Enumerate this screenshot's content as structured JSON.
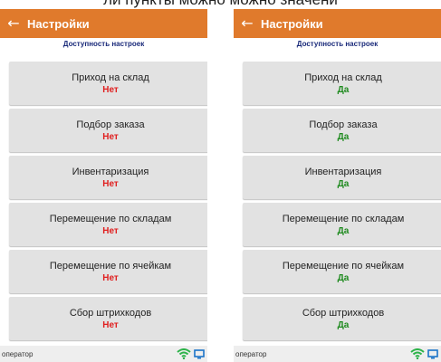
{
  "caption": "ли пункты можно можно значени",
  "screens": [
    {
      "header": {
        "title": "Настройки"
      },
      "subtitle": "Доступность настроек",
      "items": [
        {
          "label": "Приход на склад",
          "value": "Нет"
        },
        {
          "label": "Подбор заказа",
          "value": "Нет"
        },
        {
          "label": "Инвентаризация",
          "value": "Нет"
        },
        {
          "label": "Перемещение по складам",
          "value": "Нет"
        },
        {
          "label": "Перемещение по ячейкам",
          "value": "Нет"
        },
        {
          "label": "Сбор штрихкодов",
          "value": "Нет"
        }
      ],
      "status": {
        "user": "оператор"
      }
    },
    {
      "header": {
        "title": "Настройки"
      },
      "subtitle": "Доступность настроек",
      "items": [
        {
          "label": "Приход на склад",
          "value": "Да"
        },
        {
          "label": "Подбор заказа",
          "value": "Да"
        },
        {
          "label": "Инвентаризация",
          "value": "Да"
        },
        {
          "label": "Перемещение по складам",
          "value": "Да"
        },
        {
          "label": "Перемещение по ячейкам",
          "value": "Да"
        },
        {
          "label": "Сбор штрихкодов",
          "value": "Да"
        }
      ],
      "status": {
        "user": "оператор"
      }
    }
  ],
  "colors": {
    "appbar": "#e07a2c",
    "no": "#e02020",
    "yes": "#1e8a1e",
    "wifi": "#2db34a",
    "screen_icon": "#1b74c9"
  }
}
